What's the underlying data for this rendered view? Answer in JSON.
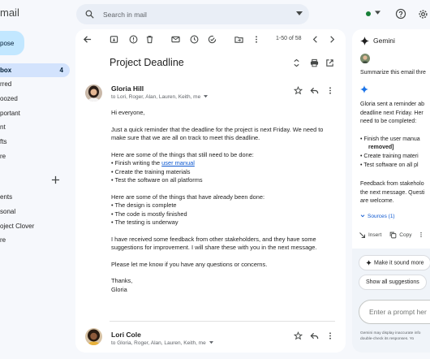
{
  "app": {
    "logo_text": "mail"
  },
  "search": {
    "placeholder": "Search in mail"
  },
  "sidebar": {
    "compose_label": "pose",
    "items": [
      {
        "label": "box",
        "count": "4"
      },
      {
        "label": "rred"
      },
      {
        "label": "oozed"
      },
      {
        "label": "portant"
      },
      {
        "label": "nt"
      },
      {
        "label": "fts"
      },
      {
        "label": "re"
      }
    ],
    "labels": [
      {
        "label": "ents"
      },
      {
        "label": "sonal"
      },
      {
        "label": "oject Clover"
      },
      {
        "label": "re"
      }
    ]
  },
  "toolbar": {
    "page_count": "1-50 of 58"
  },
  "email": {
    "subject": "Project Deadline",
    "sender": "Gloria Hill",
    "recipients": "to Lori, Roger, Alan, Lauren, Keith, me",
    "greeting": "Hi everyone,",
    "para1": "Just a quick reminder that the deadline for the project is next Friday. We need to make sure that we are all on track to meet this deadline.",
    "todo_intro": "Here are some of the things that still need to be done:",
    "todo_1_prefix": "Finish writing the ",
    "todo_1_link": "user manual",
    "todo_2": "Create the training materials",
    "todo_3": "Test the software on all platforms",
    "done_intro": "Here are some of the things that have already been done:",
    "done_1": "The design is complete",
    "done_2": "The code is mostly finished",
    "done_3": "The testing is underway",
    "para2": "I have received some feedback from other stakeholders, and they have some suggestions for improvement. I will share these with you in the next message.",
    "para3": "Please let me know if you have any questions or concerns.",
    "signoff": "Thanks,",
    "signature": "Gloria"
  },
  "reply": {
    "sender": "Lori Cole",
    "recipients": "to Gloria, Roger, Alan, Lauren, Keith, me"
  },
  "gemini": {
    "title": "Gemini",
    "user_prompt": "Summarize this email thre",
    "resp_1": "Gloria sent a reminder ab",
    "resp_2": "deadline next Friday. Her",
    "resp_3": "need to be completed:",
    "bullet_1a": "Finish the user manua",
    "bullet_1b": "removed]",
    "bullet_2": "Create training materi",
    "bullet_3": "Test software on all pl",
    "feedback_1": "Feedback from stakeholo",
    "feedback_2": "the next message. Questi",
    "feedback_3": "are welcome.",
    "sources": "Sources (1)",
    "insert": "Insert",
    "copy": "Copy",
    "chip_1": "Make it sound more",
    "chip_2": "Show all suggestions",
    "prompt_placeholder": "Enter a prompt her",
    "disclaimer_1": "Gemini may display inaccurate info",
    "disclaimer_2": "double-check its responses. Yo"
  },
  "colors": {
    "background": "#f6f8fc",
    "compose": "#c2e7ff",
    "active_nav": "#d3e3fd",
    "link": "#0b57d0",
    "status": "#188038"
  }
}
